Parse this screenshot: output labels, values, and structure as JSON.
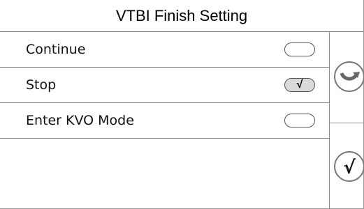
{
  "header": {
    "title": "VTBI Finish Setting"
  },
  "options": [
    {
      "label": "Continue",
      "selected": false
    },
    {
      "label": "Stop",
      "selected": true,
      "mark": "√"
    },
    {
      "label": "Enter KVO Mode",
      "selected": false
    }
  ],
  "side_buttons": {
    "back_icon": "undo-arrow-icon",
    "confirm_label": "√"
  },
  "colors": {
    "border": "#7a7a7a",
    "selected_fill": "#d9d9d9"
  }
}
